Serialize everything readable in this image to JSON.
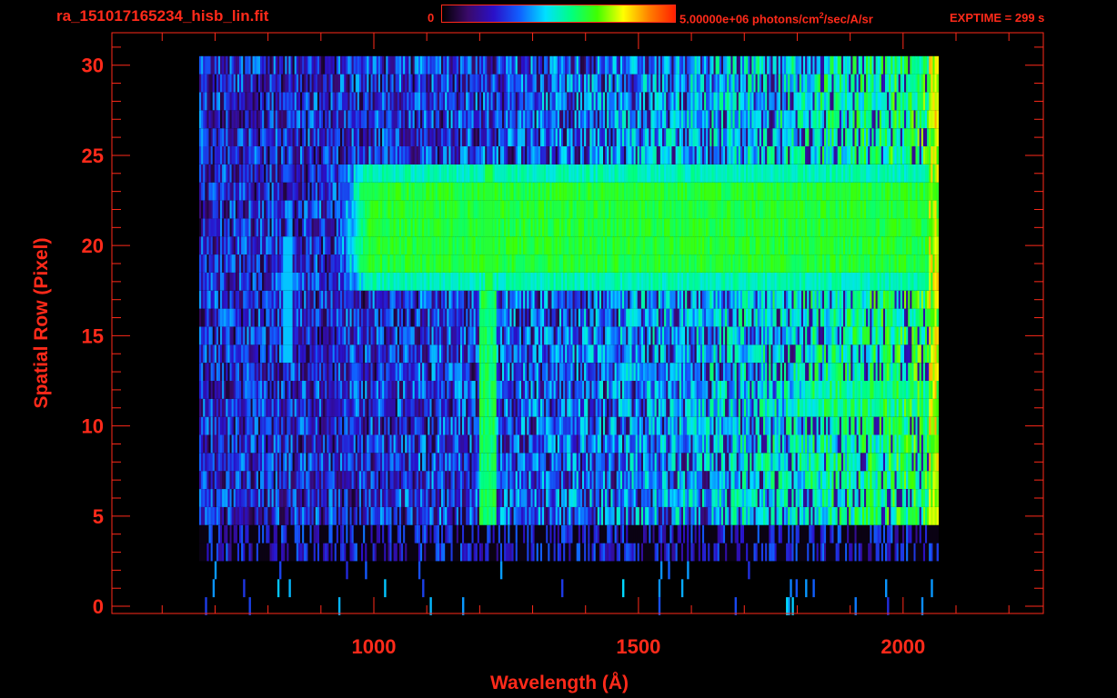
{
  "header": {
    "filename": "ra_151017165234_hisb_lin.fit",
    "colorbar_min_label": "0",
    "colorbar_max_value": "5.00000e+06 photons/cm",
    "colorbar_max_exp": "2",
    "colorbar_max_suffix": "/sec/A/sr",
    "exptime_label": "EXPTIME = 299 s"
  },
  "colors": {
    "axis": "#ff2a1a",
    "background": "#000000",
    "colormap": [
      "#000000",
      "#3a0a6a",
      "#2a10c8",
      "#1060ff",
      "#00e0ff",
      "#00ff80",
      "#40ff00",
      "#ffff00",
      "#ff8000",
      "#ff2000"
    ]
  },
  "chart_data": {
    "type": "heatmap",
    "title": "",
    "xlabel": "Wavelength (Å)",
    "ylabel": "Spatial Row (Pixel)",
    "xlim": [
      505,
      2265
    ],
    "ylim": [
      -0.4,
      31.8
    ],
    "x_ticks": [
      1000,
      1500,
      2000
    ],
    "y_ticks": [
      0,
      5,
      10,
      15,
      20,
      25,
      30
    ],
    "x_minor_step": 100,
    "y_minor_step": 1,
    "colorbar_range": [
      0,
      5000000
    ],
    "data_x_range": [
      670,
      2065
    ],
    "data_y_range": [
      0,
      30
    ],
    "bright_band_rows": [
      18,
      24
    ],
    "bright_band_start": 925,
    "emission_line_wavelength": 1215,
    "emission_line_rows": [
      5,
      17
    ],
    "blob_wavelength": 835,
    "blob_rows": [
      14,
      20
    ],
    "lower_band_rows": [
      11,
      12
    ],
    "lower_band_start": 1700
  }
}
